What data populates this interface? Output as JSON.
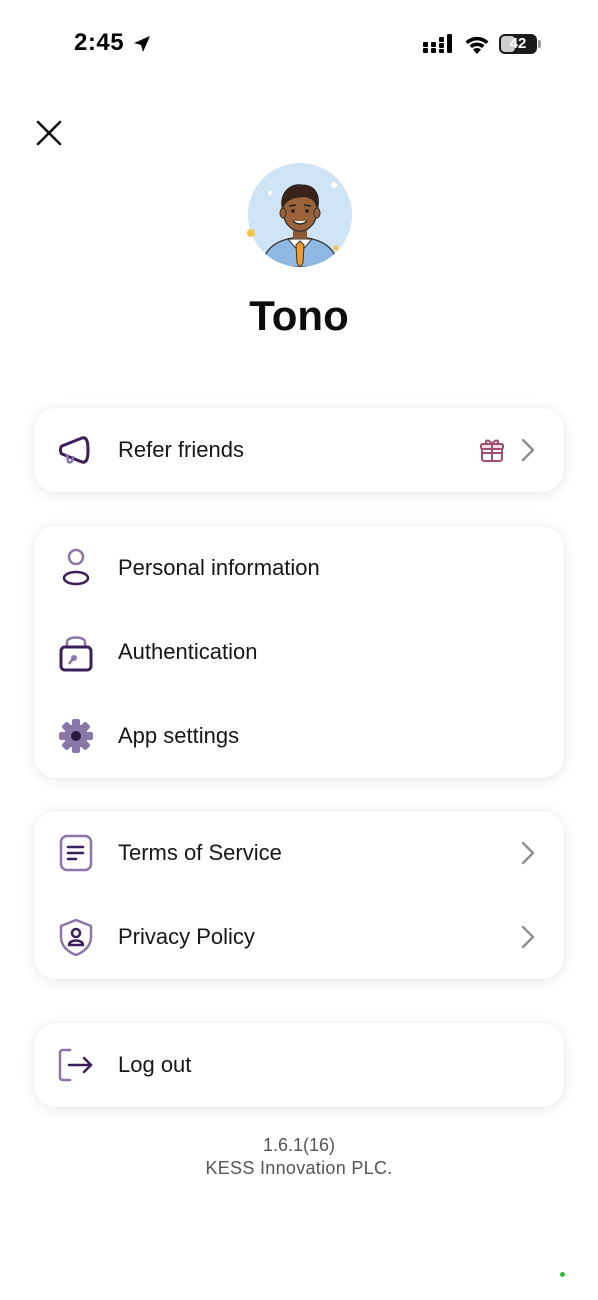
{
  "status_bar": {
    "time": "2:45",
    "battery_level": "42",
    "battery_fraction": 0.42
  },
  "profile": {
    "name": "Tono",
    "avatar_icon": "avatar-illustration-icon"
  },
  "sections": {
    "refer": {
      "label": "Refer friends",
      "icon": "megaphone-icon",
      "badge_icon": "gift-icon"
    },
    "account": {
      "personal_info": {
        "label": "Personal information",
        "icon": "person-icon"
      },
      "authentication": {
        "label": "Authentication",
        "icon": "lock-icon"
      },
      "app_settings": {
        "label": "App settings",
        "icon": "gear-icon"
      }
    },
    "legal": {
      "terms": {
        "label": "Terms of Service",
        "icon": "document-icon"
      },
      "privacy": {
        "label": "Privacy Policy",
        "icon": "shield-user-icon"
      }
    },
    "logout": {
      "label": "Log out",
      "icon": "logout-icon"
    }
  },
  "footer": {
    "version": "1.6.1(16)",
    "company": "KESS Innovation PLC."
  },
  "colors": {
    "accent": "#3b1f5a",
    "accent_light": "#8a76a8",
    "gift": "#a0506e",
    "chevron": "#8e8e8e"
  }
}
